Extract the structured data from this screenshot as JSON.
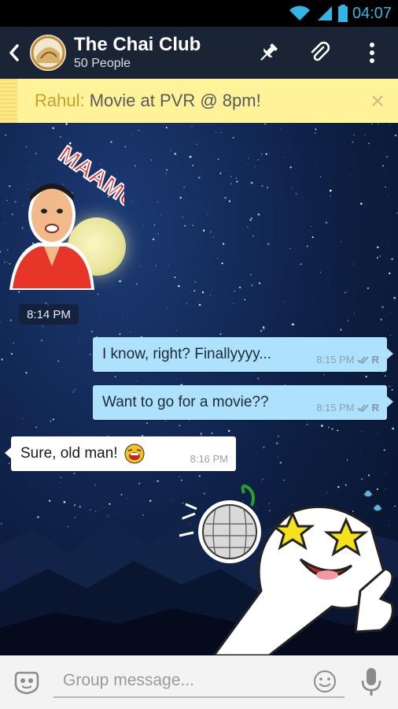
{
  "status_bar": {
    "time": "04:07"
  },
  "header": {
    "title": "The Chai Club",
    "subtitle": "50 People",
    "icons": [
      "back-arrow-icon",
      "pin-icon",
      "attach-icon",
      "overflow-menu-icon"
    ]
  },
  "pinned": {
    "sender": "Rahul:",
    "message": "Movie at PVR @ 8pm!"
  },
  "chat": {
    "sticker_time": "8:14 PM",
    "messages": [
      {
        "direction": "out",
        "text": "I know, right? Finallyyyy...",
        "time": "8:15 PM",
        "receipt": "R"
      },
      {
        "direction": "out",
        "text": "Want to go for a movie??",
        "time": "8:15 PM",
        "receipt": "R"
      },
      {
        "direction": "in",
        "text": "Sure, old man!",
        "time": "8:16 PM"
      }
    ],
    "sticker_text": "MAAMU"
  },
  "composer": {
    "placeholder": "Group message..."
  },
  "colors": {
    "accent": "#33b5e5",
    "header_bg": "#1b2434",
    "pinned_bg": "#fff39a",
    "out_bubble": "#aee1fb",
    "in_bubble": "#ffffff"
  }
}
